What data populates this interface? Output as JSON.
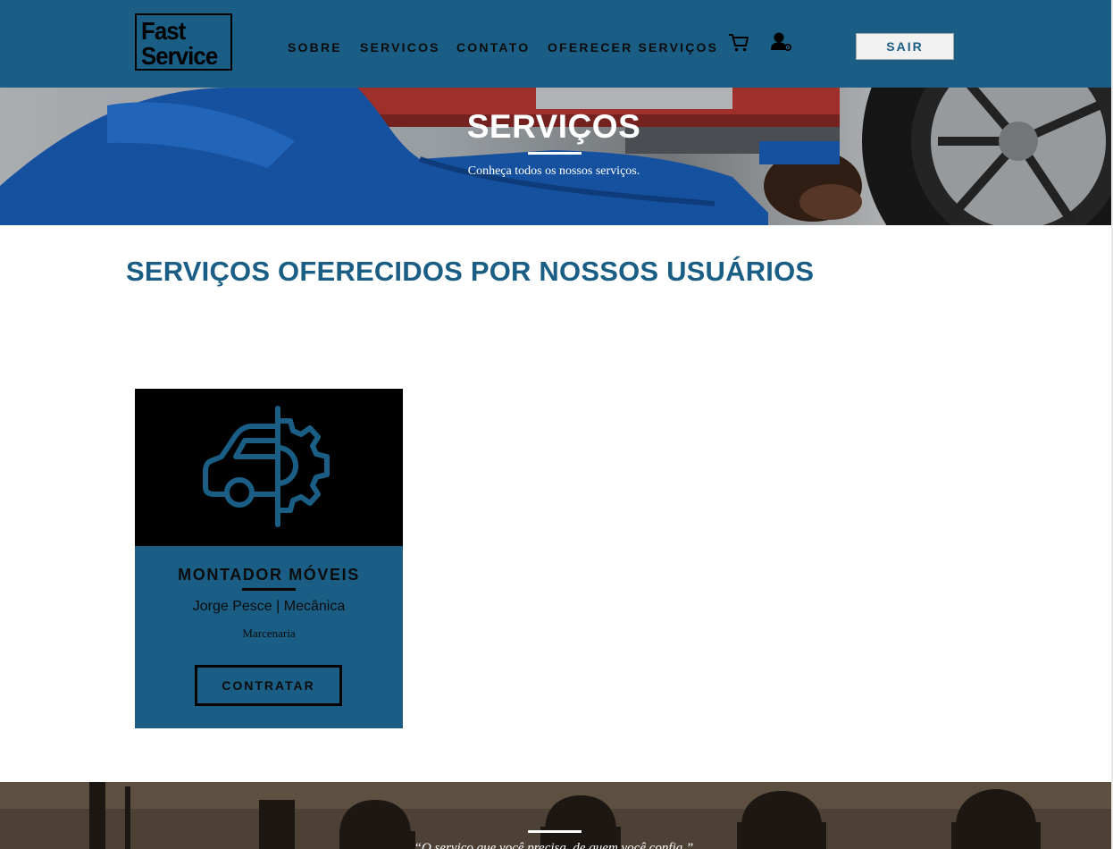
{
  "header": {
    "logo_line1": "Fast",
    "logo_line2": "Service",
    "nav": [
      {
        "label": "SOBRE"
      },
      {
        "label": "SERVICOS"
      },
      {
        "label": "CONTATO"
      },
      {
        "label": "OFERECER SERVIÇOS"
      }
    ],
    "cart_icon": "shopping-cart-icon",
    "user_icon": "user-settings-icon",
    "logout_label": "SAIR"
  },
  "hero": {
    "title": "SERVIÇOS",
    "subtitle": "Conheça todos os nossos serviços."
  },
  "section": {
    "title": "SERVIÇOS OFERECIDOS POR NOSSOS USUÁRIOS"
  },
  "cards": [
    {
      "icon": "car-gear-icon",
      "title": "MONTADOR MÓVEIS",
      "subtitle": "Jorge Pesce | Mecânica",
      "category": "Marcenaria",
      "button_label": "CONTRATAR"
    }
  ],
  "footer": {
    "quote": "“O serviço que você precisa, de quem você confia.”"
  },
  "colors": {
    "primary": "#1a5e85",
    "dark": "#000000",
    "white": "#ffffff"
  }
}
